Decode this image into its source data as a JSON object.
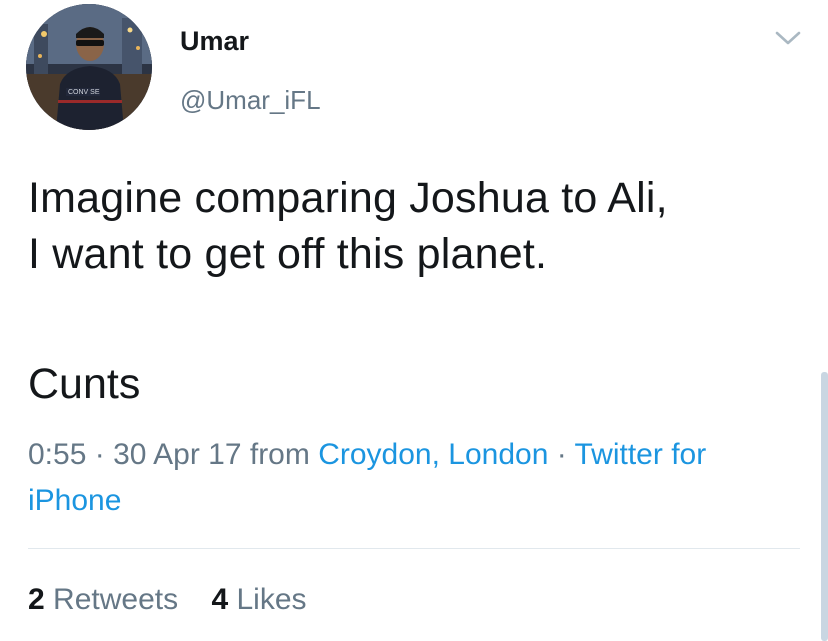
{
  "author": {
    "name": "Umar",
    "handle": "@Umar_iFL",
    "avatar_shirt_text": "CONV  SE"
  },
  "tweet": {
    "line1": "Imagine comparing Joshua to Ali,\nI want to get off this planet.",
    "line2": "Cunts"
  },
  "meta": {
    "time": "0:55",
    "date": "30 Apr 17",
    "from_label": "from",
    "location": "Croydon, London",
    "source": "Twitter for iPhone",
    "separator": "·"
  },
  "stats": {
    "retweets_count": "2",
    "retweets_label": "Retweets",
    "likes_count": "4",
    "likes_label": "Likes"
  },
  "colors": {
    "link": "#1b95e0",
    "muted": "#657786",
    "text": "#14171a",
    "divider": "#e1e8ed"
  },
  "icons": {
    "menu": "chevron-down-icon"
  }
}
